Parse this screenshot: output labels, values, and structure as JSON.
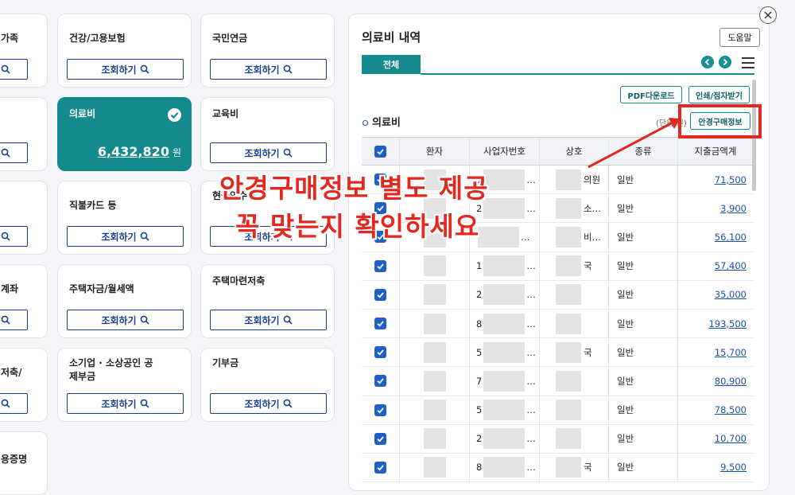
{
  "cards": [
    {
      "title": "가족",
      "button": "조회하기"
    },
    {
      "title": "건강/고용보험",
      "button": "조회하기"
    },
    {
      "title": "국민연금",
      "button": "조회하기"
    },
    {
      "title": "",
      "button": "조회하기"
    },
    {
      "title": "의료비",
      "amount": "6,432,820",
      "unit": "원",
      "selected": true
    },
    {
      "title": "교육비",
      "button": "조회하기"
    },
    {
      "title": "",
      "button": "조회하기"
    },
    {
      "title": "직불카드 등",
      "button": "조회하기"
    },
    {
      "title": "현금영수증",
      "button": "조회하기"
    },
    {
      "title": "계좌",
      "button": "조회하기"
    },
    {
      "title": "주택자금/월세액",
      "button": "조회하기"
    },
    {
      "title": "주택마련저축",
      "button": "조회하기"
    },
    {
      "title": "저축/",
      "button": "조회하기"
    },
    {
      "title": "소기업 · 소상공인 공제부금",
      "button": "조회하기"
    },
    {
      "title": "기부금",
      "button": "조회하기"
    },
    {
      "title": "용증명"
    }
  ],
  "panel": {
    "title": "의료비 내역",
    "help": "도움말",
    "tab": "전체",
    "pdf_button": "PDF다운로드",
    "print_button": "인쇄/점자받기",
    "section": "의료비",
    "unit_note": "(단위:원)",
    "glasses_button": "안경구매정보",
    "columns": [
      "환자",
      "사업자번호",
      "상호",
      "종류",
      "지출금액계"
    ],
    "rows": [
      {
        "biz": "1",
        "shop": "의원",
        "type": "일반",
        "amount": "71,500"
      },
      {
        "biz": "2",
        "shop": "소…",
        "type": "일반",
        "amount": "3,900"
      },
      {
        "biz": "",
        "shop": "비…",
        "type": "일반",
        "amount": "56,100"
      },
      {
        "biz": "1",
        "shop": "국",
        "type": "일반",
        "amount": "57,400"
      },
      {
        "biz": "2",
        "shop": "",
        "type": "일반",
        "amount": "35,000"
      },
      {
        "biz": "8",
        "shop": "",
        "type": "일반",
        "amount": "193,500"
      },
      {
        "biz": "5",
        "shop": "국",
        "type": "일반",
        "amount": "15,700"
      },
      {
        "biz": "7",
        "shop": "",
        "type": "일반",
        "amount": "80,900"
      },
      {
        "biz": "5",
        "shop": "",
        "type": "일반",
        "amount": "78,500"
      },
      {
        "biz": "2",
        "shop": "",
        "type": "일반",
        "amount": "10,700"
      },
      {
        "biz": "8",
        "shop": "국",
        "type": "일반",
        "amount": "9,500"
      }
    ]
  },
  "annotation": {
    "line1": "안경구매정보 별도 제공",
    "line2": "꼭 맞는지 확인하세요",
    "color": "#e2281f"
  },
  "colors": {
    "accent": "#138a8e",
    "link": "#1b4fa8",
    "check": "#1f5fc7"
  }
}
